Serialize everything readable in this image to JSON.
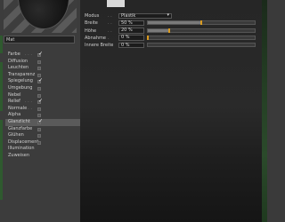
{
  "material": {
    "name": "Mat"
  },
  "channels": [
    {
      "label": "Farbe",
      "dotted": true,
      "checked": true
    },
    {
      "label": "Diffusion",
      "dotted": false,
      "checked": false
    },
    {
      "label": "Leuchten",
      "dotted": false,
      "checked": false
    },
    {
      "label": "Transparenz",
      "dotted": false,
      "checked": false
    },
    {
      "label": "Spiegelung",
      "dotted": true,
      "checked": true
    },
    {
      "label": "Umgebung",
      "dotted": false,
      "checked": false
    },
    {
      "label": "Nebel",
      "dotted": false,
      "checked": false
    },
    {
      "label": "Relief",
      "dotted": true,
      "checked": true
    },
    {
      "label": "Normale",
      "dotted": true,
      "checked": false
    },
    {
      "label": "Alpha",
      "dotted": false,
      "checked": false
    },
    {
      "label": "Glanzlicht",
      "dotted": false,
      "checked": true,
      "active": true
    },
    {
      "label": "Glanzfarbe",
      "dotted": false,
      "checked": false
    },
    {
      "label": "Glühen",
      "dotted": false,
      "checked": false
    },
    {
      "label": "Displacement",
      "dotted": false,
      "checked": false
    },
    {
      "label": "Illumination",
      "dotted": false,
      "checked": null
    },
    {
      "label": "Zuweisen",
      "dotted": false,
      "checked": null
    }
  ],
  "properties": {
    "modus": {
      "label": "Modus",
      "value": "Plastik"
    },
    "breite": {
      "label": "Breite",
      "value": "50 %",
      "level": 0.5
    },
    "hoehe": {
      "label": "Höhe",
      "value": "20 %",
      "level": 0.2
    },
    "abnahme": {
      "label": "Abnahme",
      "value": "0 %",
      "level": 0
    },
    "innere_breite": {
      "label": "Innere Breite",
      "value": "0 %",
      "level": 0
    }
  },
  "colors": {
    "accent": "#d89a20",
    "green": "#2f5a2f"
  }
}
